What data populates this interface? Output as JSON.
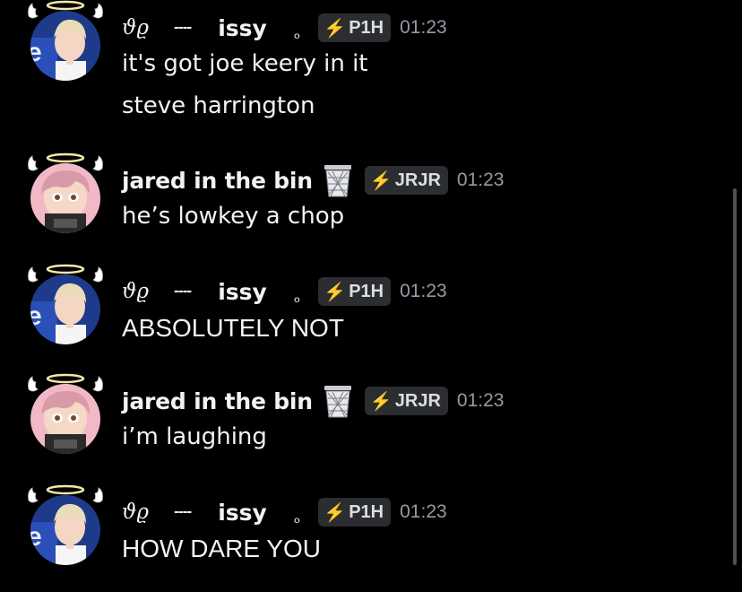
{
  "colors": {
    "background": "#000000",
    "text": "#f2f3f5",
    "timestamp": "#949ba4",
    "tag_bg": "#2b2d31"
  },
  "users": {
    "issy": {
      "glyph": "ϑϱ",
      "dash": "----",
      "name": "issy",
      "ring": "ₒ",
      "tag": "P1H",
      "avatar": "boy-photo-avatar",
      "decoration": "angel-halo-wings"
    },
    "jared": {
      "name": "jared in the bin",
      "emoji": "wastebasket-icon",
      "tag": "JRJR",
      "avatar": "anime-girl-avatar",
      "decoration": "angel-halo-wings"
    }
  },
  "messages": [
    {
      "author": "issy",
      "time": "01:23",
      "lines": [
        "it's got joe keery in it",
        "steve harrington"
      ]
    },
    {
      "author": "jared",
      "time": "01:23",
      "lines": [
        "he’s lowkey a chop"
      ]
    },
    {
      "author": "issy",
      "time": "01:23",
      "lines": [
        "ABSOLUTELY NOT"
      ]
    },
    {
      "author": "jared",
      "time": "01:23",
      "lines": [
        "i’m laughing"
      ]
    },
    {
      "author": "issy",
      "time": "01:23",
      "lines": [
        "HOW DARE YOU"
      ]
    }
  ],
  "icons": {
    "tag_icon": "lightning-bolt-icon",
    "tag_glyph": "⚡"
  }
}
